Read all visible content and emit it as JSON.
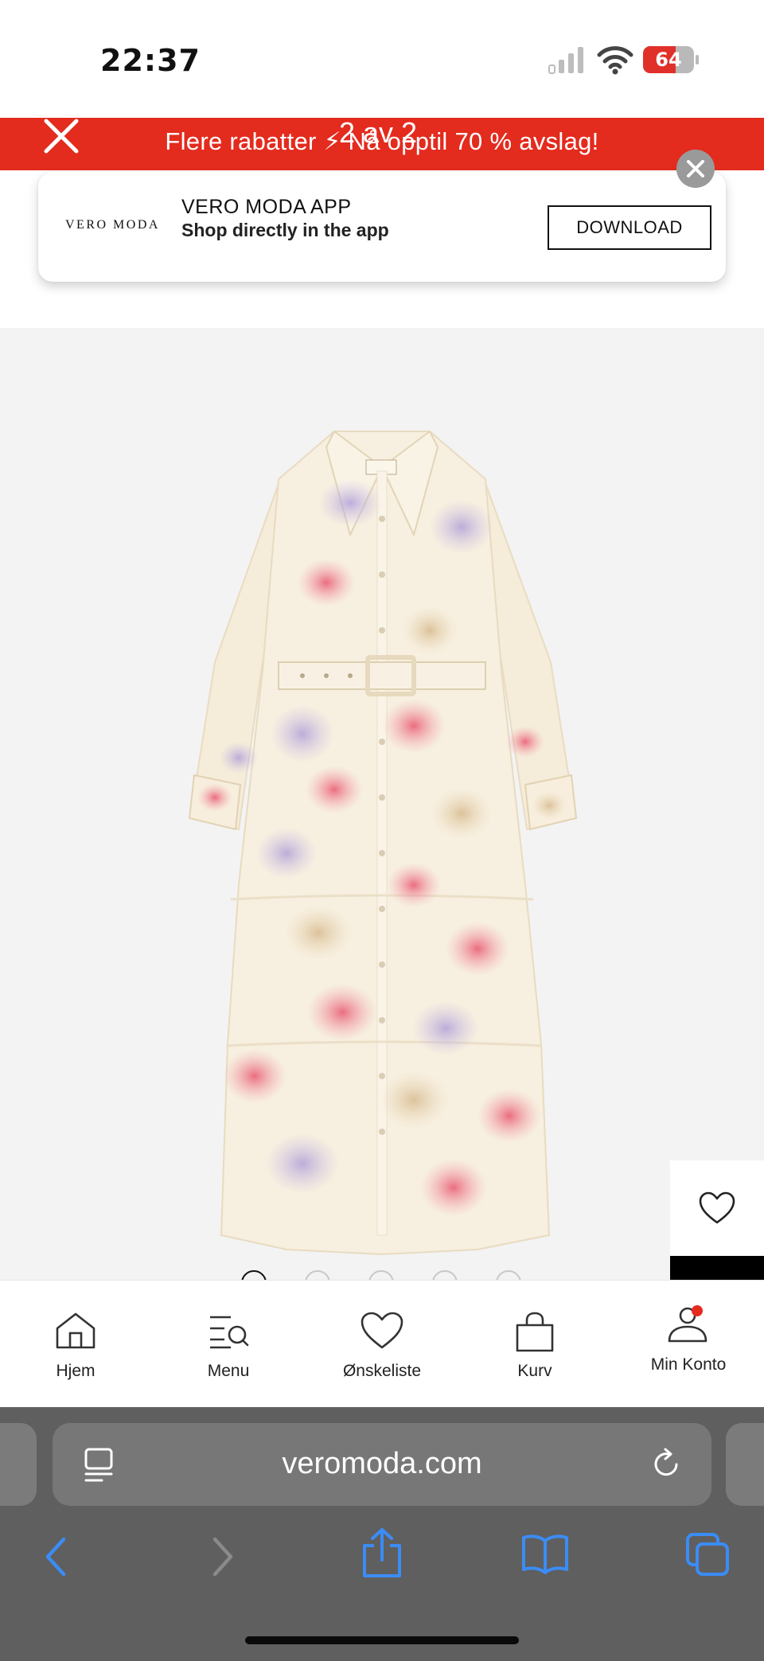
{
  "status_bar": {
    "time": "22:37",
    "battery_percent": "64",
    "battery_level": 0.64,
    "battery_color": "#e0302a"
  },
  "promo": {
    "text": "Flere rabatter ⚡ Nå opptil 70 % avslag!",
    "counter": "2 av 2",
    "background": "#e32b1e",
    "close_icon": "close-icon"
  },
  "app_banner": {
    "logo": "VERO MODA",
    "title": "VERO MODA APP",
    "subtitle": "Shop directly in the app",
    "download_label": "DOWNLOAD",
    "close_icon": "close-circle-icon"
  },
  "product": {
    "image_icon": "floral-shirt-dress-image",
    "wishlist_icon": "heart-icon",
    "image_count": 5,
    "active_image": 1
  },
  "bottom_nav": {
    "items": [
      {
        "label": "Hjem",
        "icon": "home-icon"
      },
      {
        "label": "Menu",
        "icon": "menu-search-icon"
      },
      {
        "label": "Ønskeliste",
        "icon": "heart-icon"
      },
      {
        "label": "Kurv",
        "icon": "bag-icon"
      },
      {
        "label": "Min Konto",
        "icon": "account-icon",
        "badge_color": "#e32b1e"
      }
    ]
  },
  "browser": {
    "url": "veromoda.com",
    "left_icon": "page-menu-icon",
    "reload_icon": "reload-icon",
    "toolbar": [
      "back-icon",
      "forward-icon",
      "share-icon",
      "bookmarks-icon",
      "tabs-icon"
    ]
  }
}
